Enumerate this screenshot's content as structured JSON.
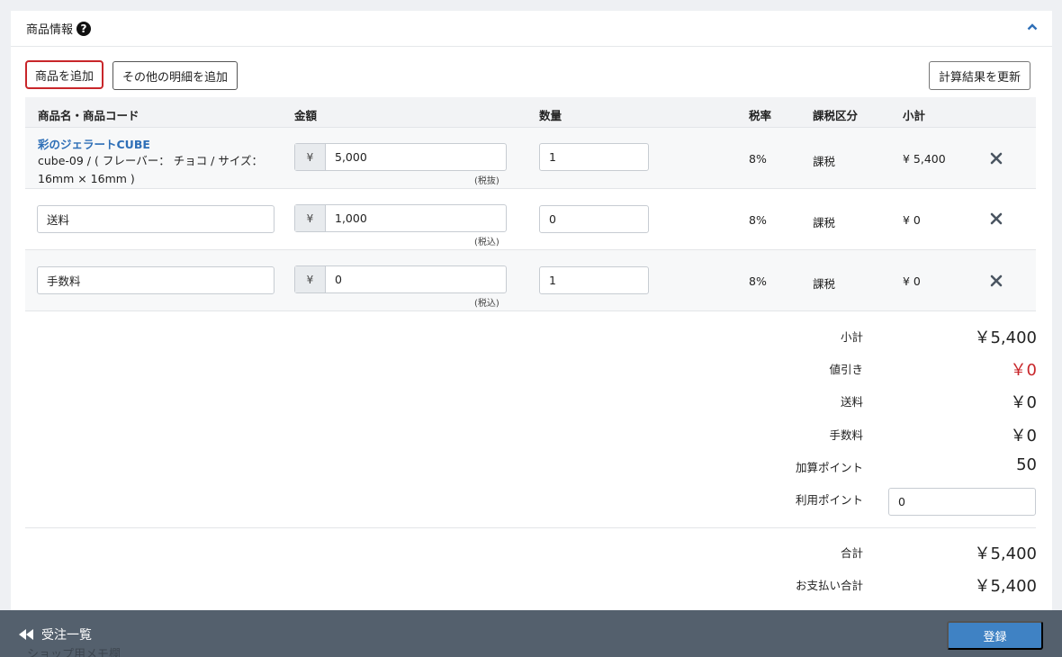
{
  "card": {
    "title": "商品情報",
    "help_glyph": "?"
  },
  "toolbar": {
    "add_product": "商品を追加",
    "add_other": "その他の明細を追加",
    "recalc": "計算結果を更新"
  },
  "table": {
    "headers": {
      "name": "商品名・商品コード",
      "price": "金額",
      "qty": "数量",
      "tax_rate": "税率",
      "tax_type": "課税区分",
      "subtotal": "小計"
    },
    "rows": [
      {
        "product_name": "彩のジェラートCUBE",
        "product_option": "cube-09 / ( フレーバー： チョコ / サイズ： 16mm × 16mm )",
        "currency": "¥",
        "price": "5,000",
        "tax_note": "(税抜)",
        "qty": "1",
        "tax_rate": "8%",
        "tax_type": "課税",
        "subtotal": "¥ 5,400"
      },
      {
        "item_name": "送料",
        "currency": "¥",
        "price": "1,000",
        "tax_note": "(税込)",
        "qty": "0",
        "tax_rate": "8%",
        "tax_type": "課税",
        "subtotal": "¥ 0"
      },
      {
        "item_name": "手数料",
        "currency": "¥",
        "price": "0",
        "tax_note": "(税込)",
        "qty": "1",
        "tax_rate": "8%",
        "tax_type": "課税",
        "subtotal": "¥ 0"
      }
    ]
  },
  "summary": {
    "subtotal_label": "小計",
    "subtotal_value": "￥5,400",
    "discount_label": "値引き",
    "discount_value": "￥0",
    "shipping_label": "送料",
    "shipping_value": "￥0",
    "fee_label": "手数料",
    "fee_value": "￥0",
    "add_points_label": "加算ポイント",
    "add_points_value": "50",
    "use_points_label": "利用ポイント",
    "use_points_value": "0",
    "total_label": "合計",
    "total_value": "￥5,400",
    "payment_total_label": "お支払い合計",
    "payment_total_value": "￥5,400"
  },
  "footer": {
    "back_label": "受注一覧",
    "register_label": "登録",
    "ghost_text": "ショップ用メモ欄"
  },
  "colors": {
    "link_blue": "#2e6fb7",
    "discount_red": "#c8262a",
    "primary_button": "#3f82c4",
    "footer_bg": "#54606d"
  }
}
